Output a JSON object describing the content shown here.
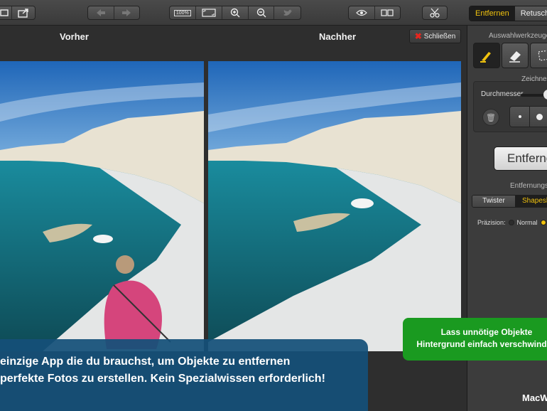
{
  "toolbar": {
    "zoom_fit_label": "100%",
    "buttons": [
      "undo",
      "redo"
    ]
  },
  "tabs": {
    "remove": "Entfernen",
    "retouch": "Retuschieren"
  },
  "canvas": {
    "before_label": "Vorher",
    "after_label": "Nachher",
    "close_label": "Schließen"
  },
  "panel": {
    "selection_tools_title": "Auswahlwerkzeuge",
    "draw_title": "Zeichnen",
    "diameter_label": "Durchmesser",
    "remove_button": "Entfernen",
    "removal_mode_title": "Entfernungsmodus",
    "mode_twister": "Twister",
    "mode_shapeshift": "Shapeshift",
    "precision_label": "Präzision:",
    "precision_normal": "Normal"
  },
  "banner": {
    "line1": "einzige App die du brauchst, um Objekte zu entfernen",
    "line2": "perfekte Fotos zu erstellen. Kein Spezialwissen erforderlich!"
  },
  "green_banner": {
    "line1": "Lass unnötige Objekte",
    "line2": "Hintergrund einfach verschwinden"
  },
  "brand": "MacW",
  "colors": {
    "accent": "#f0c20e",
    "close_x": "#e8261e",
    "banner_blue": "#145078",
    "banner_green": "#1a9a20"
  }
}
